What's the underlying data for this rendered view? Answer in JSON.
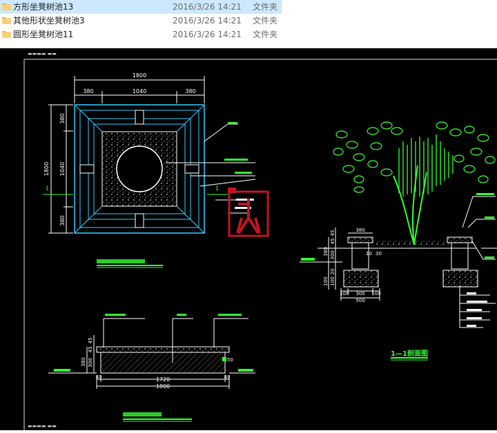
{
  "files": [
    {
      "name": "方形坐凳树池13",
      "date": "2016/3/26 14:21",
      "type": "文件夹"
    },
    {
      "name": "其他形状坐凳树池3",
      "date": "2016/3/26 14:21",
      "type": "文件夹"
    },
    {
      "name": "圆形坐凳树池11",
      "date": "2016/3/26 14:21",
      "type": "文件夹"
    }
  ],
  "drawing": {
    "plan": {
      "overall": "1800",
      "left": "380",
      "mid": "1040",
      "right": "380",
      "v_top": "380",
      "v_mid": "1040",
      "v_bot": "380",
      "sec_mark": "1"
    },
    "elevation": {
      "d1": "40",
      "d2": "1720",
      "d3": "40",
      "total": "1800",
      "h1": "380",
      "h2": "300",
      "h3": "45",
      "h4": "45",
      "side": "50"
    },
    "section": {
      "top": "380",
      "left": "100",
      "mid": "300",
      "right": "100",
      "total": "500",
      "h1": "380",
      "h2": "300",
      "h3": "45",
      "h4": "45",
      "g1": "20",
      "g2": "100",
      "g3": "100",
      "s1": "10",
      "s2": "30",
      "title": "1—1剖面图"
    }
  }
}
